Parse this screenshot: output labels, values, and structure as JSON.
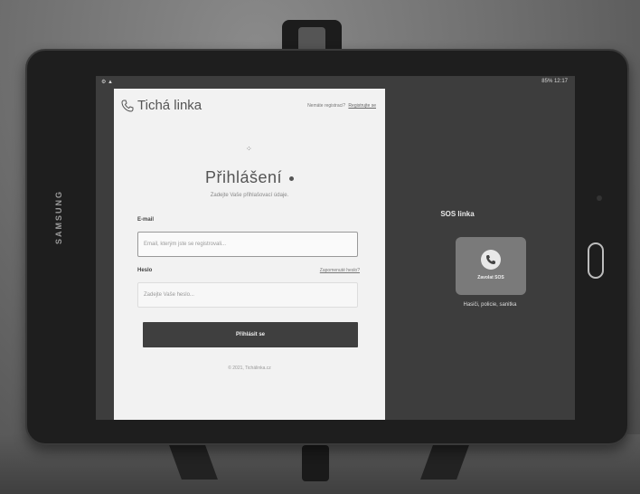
{
  "device": {
    "brand": "SAMSUNG",
    "status_right": "85% 12:17"
  },
  "app": {
    "logo_text": "Tichá linka",
    "register_prompt": "Nemáte registraci?",
    "register_link": "Registrujte se"
  },
  "login": {
    "title": "Přihlášení",
    "subtitle": "Zadejte Vaše přihlašovací údaje.",
    "email_label": "E-mail",
    "email_placeholder": "Email, kterým jste se registrovali...",
    "password_label": "Heslo",
    "forgot_link": "Zapomenuté heslo?",
    "password_placeholder": "Zadejte Vaše heslo...",
    "submit_label": "Přihlásit se",
    "copyright": "© 2021, Tichálinka.cz"
  },
  "sos": {
    "title": "SOS linka",
    "button_label": "Zavolat SOS",
    "description": "Hasiči, policie, sanitka"
  },
  "colors": {
    "panel_bg": "#f2f2f2",
    "button_bg": "#3f3f3f",
    "screen_bg": "#3d3d3d"
  }
}
